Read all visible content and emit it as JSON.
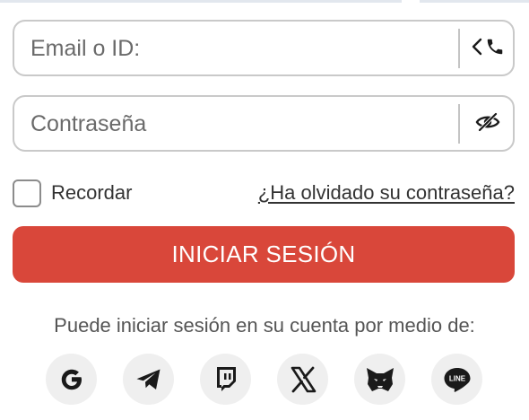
{
  "login": {
    "email_placeholder": "Email o ID:",
    "password_placeholder": "Contraseña",
    "remember_label": "Recordar",
    "forgot_link": "¿Ha olvidado su contraseña?",
    "submit_label": "INICIAR SESIÓN",
    "remember_checked": false
  },
  "social": {
    "caption": "Puede iniciar sesión en su cuenta por medio de:",
    "providers": [
      {
        "name": "Google",
        "icon": "google-icon"
      },
      {
        "name": "Telegram",
        "icon": "telegram-icon"
      },
      {
        "name": "Twitch",
        "icon": "twitch-icon"
      },
      {
        "name": "X",
        "icon": "x-icon"
      },
      {
        "name": "MetaMask",
        "icon": "metamask-fox-icon"
      },
      {
        "name": "LINE",
        "icon": "line-icon"
      }
    ],
    "line_badge_text": "LINE"
  },
  "colors": {
    "accent": "#d9473a",
    "field_border": "#c9c9c9",
    "social_bg": "#efefef",
    "icon": "#1a1a1a"
  }
}
